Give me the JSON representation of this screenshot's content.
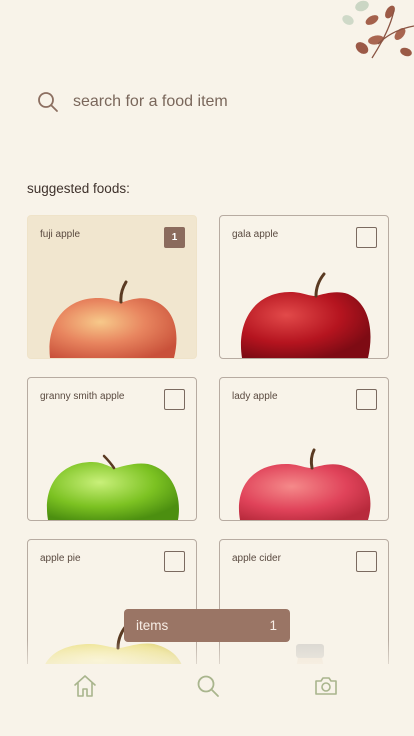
{
  "search": {
    "placeholder": "search for a food item"
  },
  "section_title": "suggested foods:",
  "foods": [
    {
      "label": "fuji apple",
      "selected": true,
      "count": "1"
    },
    {
      "label": "gala apple",
      "selected": false,
      "count": ""
    },
    {
      "label": "granny smith apple",
      "selected": false,
      "count": ""
    },
    {
      "label": "lady apple",
      "selected": false,
      "count": ""
    },
    {
      "label": "apple pie",
      "selected": false,
      "count": ""
    },
    {
      "label": "apple cider",
      "selected": false,
      "count": ""
    }
  ],
  "basket": {
    "label": "items",
    "count": "1"
  },
  "nav": {
    "items": [
      {
        "icon": "home-icon"
      },
      {
        "icon": "search-icon"
      },
      {
        "icon": "camera-icon"
      }
    ]
  },
  "colors": {
    "background": "#f8f3e9",
    "accent": "#9a7565",
    "nav_icon": "#a9b58d",
    "card_border": "#b7aba1"
  }
}
